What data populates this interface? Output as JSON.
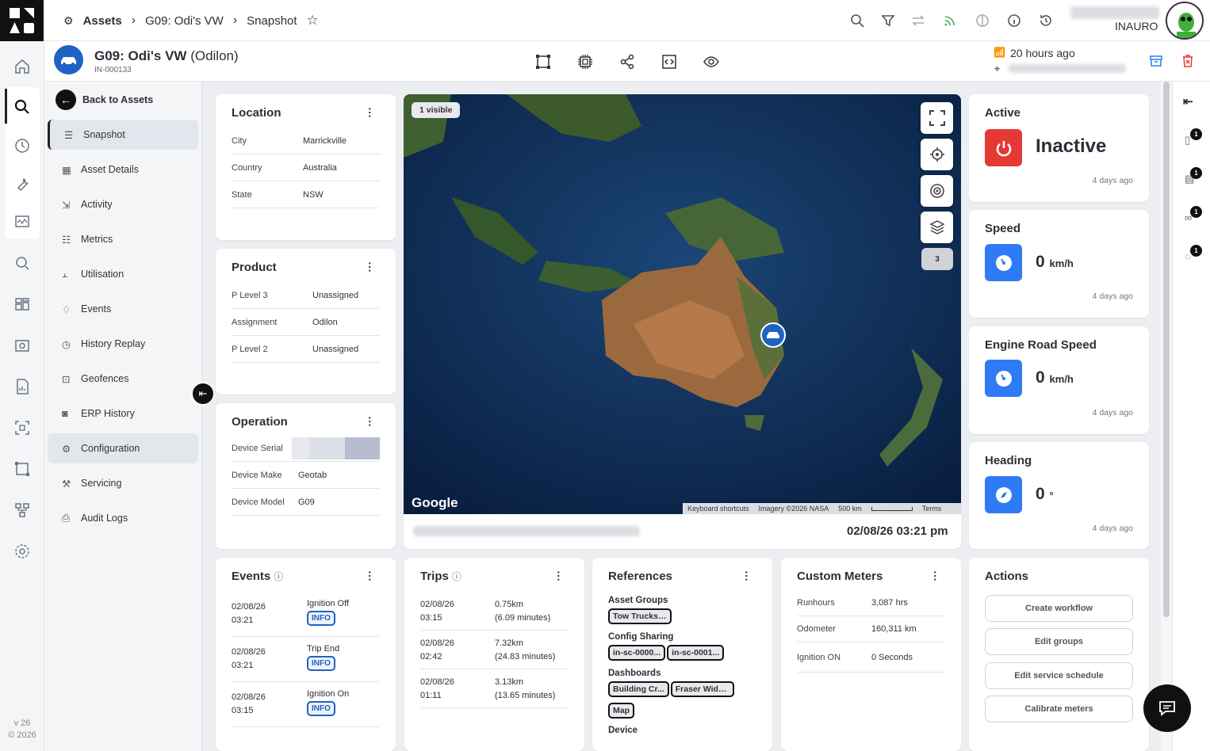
{
  "header": {
    "breadcrumb": [
      "Assets",
      "G09: Odi's VW",
      "Snapshot"
    ],
    "user": "INAURO"
  },
  "asset": {
    "title": "G09: Odi's VW",
    "owner": "(Odilon)",
    "id": "IN-000133",
    "last_seen": "20 hours ago"
  },
  "sidebar": {
    "back": "Back to Assets",
    "items": [
      {
        "label": "Snapshot",
        "icon": "list-icon"
      },
      {
        "label": "Asset Details",
        "icon": "grid-icon"
      },
      {
        "label": "Activity",
        "icon": "activity-icon"
      },
      {
        "label": "Metrics",
        "icon": "metrics-icon"
      },
      {
        "label": "Utilisation",
        "icon": "chart-icon"
      },
      {
        "label": "Events",
        "icon": "bell-icon"
      },
      {
        "label": "History Replay",
        "icon": "clock-icon"
      },
      {
        "label": "Geofences",
        "icon": "geofence-icon"
      },
      {
        "label": "ERP History",
        "icon": "erp-icon"
      },
      {
        "label": "Configuration",
        "icon": "config-icon"
      },
      {
        "label": "Servicing",
        "icon": "wrench-icon"
      },
      {
        "label": "Audit Logs",
        "icon": "audit-icon"
      }
    ],
    "version": "v 26",
    "copyright": "© 2026"
  },
  "location": {
    "title": "Location",
    "rows": [
      {
        "k": "City",
        "v": "Marrickville"
      },
      {
        "k": "Country",
        "v": "Australia"
      },
      {
        "k": "State",
        "v": "NSW"
      }
    ]
  },
  "product": {
    "title": "Product",
    "rows": [
      {
        "k": "P Level 3",
        "v": "Unassigned"
      },
      {
        "k": "Assignment",
        "v": "Odilon"
      },
      {
        "k": "P Level 2",
        "v": "Unassigned"
      }
    ]
  },
  "operation": {
    "title": "Operation",
    "rows": [
      {
        "k": "Device Serial",
        "v": ""
      },
      {
        "k": "Device Make",
        "v": "Geotab"
      },
      {
        "k": "Device Model",
        "v": "G09"
      }
    ]
  },
  "map": {
    "visible": "1 visible",
    "layers_count": "3",
    "google": "Google",
    "footer": [
      "Keyboard shortcuts",
      "Imagery ©2026 NASA",
      "500 km",
      "Terms"
    ],
    "date": "02/08/26 03:21 pm"
  },
  "status": {
    "active": {
      "title": "Active",
      "value": "Inactive",
      "ago": "4 days ago"
    },
    "speed": {
      "title": "Speed",
      "value": "0",
      "unit": "km/h",
      "ago": "4 days ago"
    },
    "engine": {
      "title": "Engine Road Speed",
      "value": "0",
      "unit": "km/h",
      "ago": "4 days ago"
    },
    "heading": {
      "title": "Heading",
      "value": "0",
      "unit": "°",
      "ago": "4 days ago"
    }
  },
  "events": {
    "title": "Events",
    "rows": [
      {
        "date": "02/08/26",
        "time": "03:21",
        "name": "Ignition Off",
        "badge": "INFO"
      },
      {
        "date": "02/08/26",
        "time": "03:21",
        "name": "Trip End",
        "badge": "INFO"
      },
      {
        "date": "02/08/26",
        "time": "03:15",
        "name": "Ignition On",
        "badge": "INFO"
      }
    ]
  },
  "trips": {
    "title": "Trips",
    "rows": [
      {
        "date": "02/08/26",
        "time": "03:15",
        "dist": "0.75km",
        "dur": "(6.09 minutes)"
      },
      {
        "date": "02/08/26",
        "time": "02:42",
        "dist": "7.32km",
        "dur": "(24.83 minutes)"
      },
      {
        "date": "02/08/26",
        "time": "01:11",
        "dist": "3.13km",
        "dur": "(13.65 minutes)"
      }
    ]
  },
  "references": {
    "title": "References",
    "asset_groups_label": "Asset Groups",
    "asset_groups": [
      "Tow Trucks ..."
    ],
    "config_label": "Config Sharing",
    "config": [
      "in-sc-0000...",
      "in-sc-0001..."
    ],
    "dash_label": "Dashboards",
    "dash": [
      "Building Cr...",
      "Fraser Widg...",
      "Map"
    ],
    "device_label": "Device"
  },
  "meters": {
    "title": "Custom Meters",
    "rows": [
      {
        "k": "Runhours",
        "v": "3,087 hrs"
      },
      {
        "k": "Odometer",
        "v": "160,311 km"
      },
      {
        "k": "Ignition ON",
        "v": "0 Seconds"
      }
    ]
  },
  "actions": {
    "title": "Actions",
    "buttons": [
      "Create workflow",
      "Edit groups",
      "Edit service schedule",
      "Calibrate meters"
    ]
  },
  "right_rail": {
    "badges": [
      "1",
      "1",
      "1",
      "1"
    ]
  },
  "colors": {
    "brand": "#1e63c3",
    "danger": "#e53935",
    "accent": "#2f7bf5"
  }
}
